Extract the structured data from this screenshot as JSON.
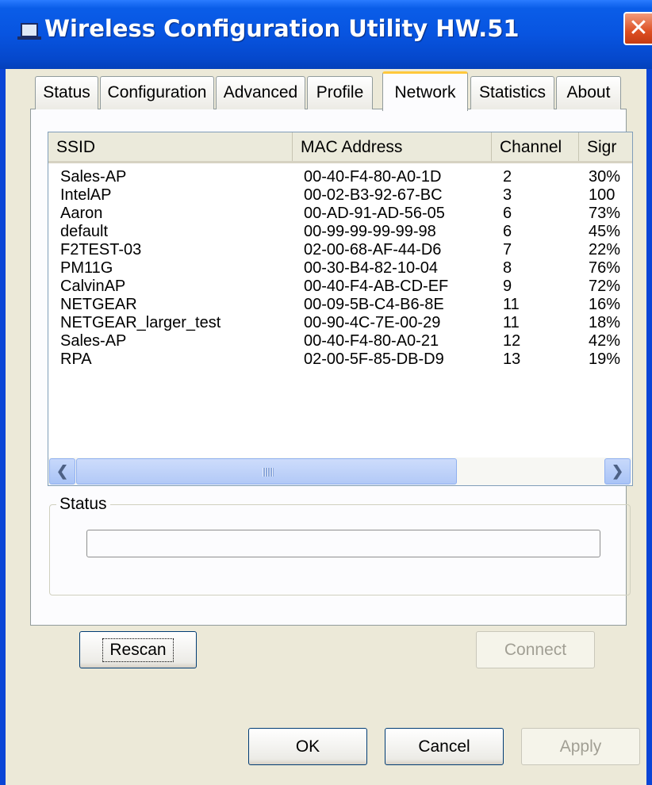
{
  "window": {
    "title": "Wireless Configuration Utility HW.51",
    "close_glyph": "✕"
  },
  "tabs": [
    {
      "label": "Status"
    },
    {
      "label": "Configuration"
    },
    {
      "label": "Advanced"
    },
    {
      "label": "Profile"
    },
    {
      "label": "Network",
      "active": true
    },
    {
      "label": "Statistics"
    },
    {
      "label": "About"
    }
  ],
  "network_list": {
    "columns": [
      "SSID",
      "MAC Address",
      "Channel",
      "Signal"
    ],
    "visible_columns_text": [
      "SSID",
      "MAC Address",
      "Channel",
      "Sigr"
    ],
    "rows": [
      {
        "ssid": "Sales-AP",
        "mac": "00-40-F4-80-A0-1D",
        "channel": "2",
        "signal": "30%"
      },
      {
        "ssid": "IntelAP",
        "mac": "00-02-B3-92-67-BC",
        "channel": "3",
        "signal": "100"
      },
      {
        "ssid": "Aaron",
        "mac": "00-AD-91-AD-56-05",
        "channel": "6",
        "signal": "73%"
      },
      {
        "ssid": "default",
        "mac": "00-99-99-99-99-98",
        "channel": "6",
        "signal": "45%"
      },
      {
        "ssid": "F2TEST-03",
        "mac": "02-00-68-AF-44-D6",
        "channel": "7",
        "signal": "22%"
      },
      {
        "ssid": "PM11G",
        "mac": "00-30-B4-82-10-04",
        "channel": "8",
        "signal": "76%"
      },
      {
        "ssid": "CalvinAP",
        "mac": "00-40-F4-AB-CD-EF",
        "channel": "9",
        "signal": "72%"
      },
      {
        "ssid": "NETGEAR",
        "mac": "00-09-5B-C4-B6-8E",
        "channel": "11",
        "signal": "16%"
      },
      {
        "ssid": "NETGEAR_larger_test",
        "mac": "00-90-4C-7E-00-29",
        "channel": "11",
        "signal": "18%"
      },
      {
        "ssid": "Sales-AP",
        "mac": "00-40-F4-80-A0-21",
        "channel": "12",
        "signal": "42%"
      },
      {
        "ssid": "RPA",
        "mac": "02-00-5F-85-DB-D9",
        "channel": "13",
        "signal": "19%"
      }
    ],
    "scroll_left_glyph": "❮",
    "scroll_right_glyph": "❯"
  },
  "status_group": {
    "label": "Status"
  },
  "buttons": {
    "rescan": "Rescan",
    "connect": "Connect",
    "ok": "OK",
    "cancel": "Cancel",
    "apply": "Apply"
  },
  "colors": {
    "titlebar": "#0854E0",
    "close_button": "#DD4F22",
    "dialog_bg": "#ECE9D8",
    "active_tab_highlight": "#FFC83C"
  }
}
